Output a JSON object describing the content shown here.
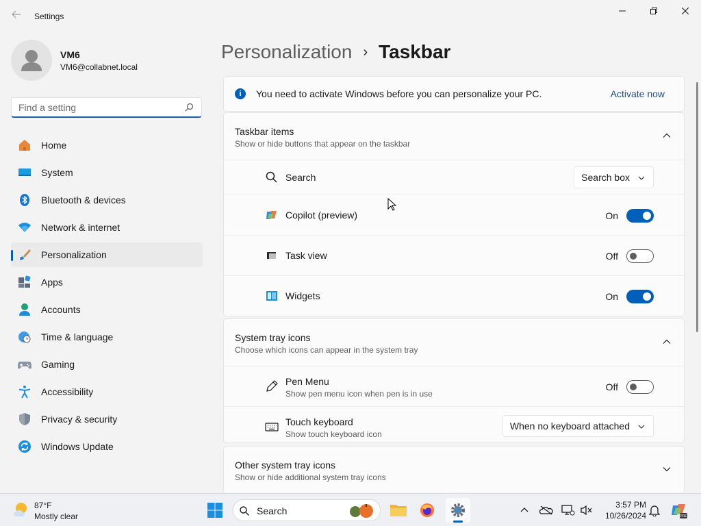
{
  "window": {
    "title": "Settings"
  },
  "profile": {
    "name": "VM6",
    "email": "VM6@collabnet.local"
  },
  "search": {
    "placeholder": "Find a setting",
    "value": ""
  },
  "nav": [
    {
      "label": "Home",
      "icon": "home-icon"
    },
    {
      "label": "System",
      "icon": "system-icon"
    },
    {
      "label": "Bluetooth & devices",
      "icon": "bluetooth-icon"
    },
    {
      "label": "Network & internet",
      "icon": "wifi-icon"
    },
    {
      "label": "Personalization",
      "icon": "brush-icon",
      "active": true
    },
    {
      "label": "Apps",
      "icon": "apps-icon"
    },
    {
      "label": "Accounts",
      "icon": "accounts-icon"
    },
    {
      "label": "Time & language",
      "icon": "globe-clock-icon"
    },
    {
      "label": "Gaming",
      "icon": "gamepad-icon"
    },
    {
      "label": "Accessibility",
      "icon": "accessibility-icon"
    },
    {
      "label": "Privacy & security",
      "icon": "shield-icon"
    },
    {
      "label": "Windows Update",
      "icon": "update-icon"
    }
  ],
  "breadcrumb": {
    "parent": "Personalization",
    "separator": "›",
    "current": "Taskbar"
  },
  "banner": {
    "text": "You need to activate Windows before you can personalize your PC.",
    "link": "Activate now"
  },
  "taskbar_items": {
    "title": "Taskbar items",
    "subtitle": "Show or hide buttons that appear on the taskbar",
    "search": {
      "label": "Search",
      "value": "Search box"
    },
    "copilot": {
      "label": "Copilot (preview)",
      "state": "On"
    },
    "task_view": {
      "label": "Task view",
      "state": "Off"
    },
    "widgets": {
      "label": "Widgets",
      "state": "On"
    }
  },
  "system_tray": {
    "title": "System tray icons",
    "subtitle": "Choose which icons can appear in the system tray",
    "pen_menu": {
      "label": "Pen Menu",
      "subtitle": "Show pen menu icon when pen is in use",
      "state": "Off"
    },
    "touch_keyboard": {
      "label": "Touch keyboard",
      "subtitle": "Show touch keyboard icon",
      "value": "When no keyboard attached"
    }
  },
  "other_tray": {
    "title": "Other system tray icons",
    "subtitle": "Show or hide additional system tray icons"
  },
  "taskbar": {
    "weather_temp": "87°F",
    "weather_cond": "Mostly clear",
    "search_label": "Search",
    "time": "3:57 PM",
    "date": "10/26/2024"
  },
  "colors": {
    "accent": "#005fb8",
    "background": "#f3f3f3",
    "card": "#fbfbfb"
  }
}
